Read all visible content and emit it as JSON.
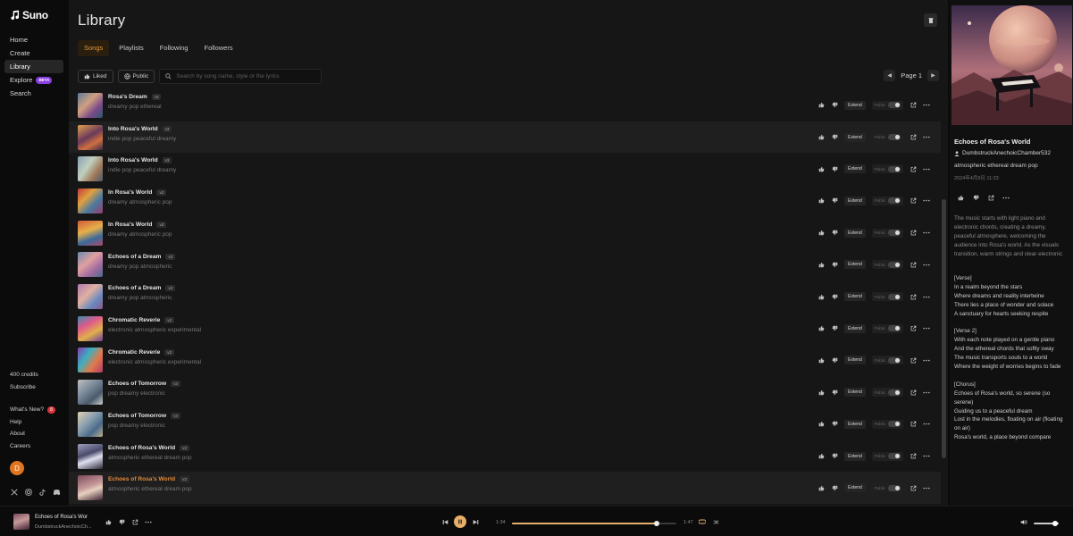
{
  "sidebar": {
    "logo": "Suno",
    "nav": [
      {
        "label": "Home"
      },
      {
        "label": "Create"
      },
      {
        "label": "Library"
      },
      {
        "label": "Explore",
        "badge": "BETA"
      },
      {
        "label": "Search"
      }
    ],
    "credits": "400 credits",
    "subscribe": "Subscribe",
    "whats_new": "What's New?",
    "whats_new_count": "8",
    "help": "Help",
    "about": "About",
    "careers": "Careers",
    "avatar_letter": "D"
  },
  "library": {
    "title": "Library",
    "tabs": [
      "Songs",
      "Playlists",
      "Following",
      "Followers"
    ],
    "active_tab": "Songs",
    "filters": {
      "liked": "Liked",
      "public": "Public"
    },
    "search_placeholder": "Search by song name, style or the lyrics",
    "page_label": "Page 1",
    "extend_label": "Extend",
    "public_label": "Public",
    "songs": [
      {
        "title": "Rosa's Dream",
        "version": "v3",
        "style": "dreamy pop ethereal"
      },
      {
        "title": "Into Rosa's World",
        "version": "v3",
        "style": "indie pop peaceful dreamy"
      },
      {
        "title": "Into Rosa's World",
        "version": "v3",
        "style": "indie pop peaceful dreamy"
      },
      {
        "title": "In Rosa's World",
        "version": "v3",
        "style": "dreamy atmospheric pop"
      },
      {
        "title": "In Rosa's World",
        "version": "v3",
        "style": "dreamy atmospheric pop"
      },
      {
        "title": "Echoes of a Dream",
        "version": "v3",
        "style": "dreamy pop atmospheric"
      },
      {
        "title": "Echoes of a Dream",
        "version": "v3",
        "style": "dreamy pop atmospheric"
      },
      {
        "title": "Chromatic Reverie",
        "version": "v3",
        "style": "electronic atmospheric experimental"
      },
      {
        "title": "Chromatic Reverie",
        "version": "v3",
        "style": "electronic atmospheric experimental"
      },
      {
        "title": "Echoes of Tomorrow",
        "version": "v3",
        "style": "pop dreamy electronic"
      },
      {
        "title": "Echoes of Tomorrow",
        "version": "v3",
        "style": "pop dreamy electronic"
      },
      {
        "title": "Echoes of Rosa's World",
        "version": "v3",
        "style": "atmospheric ethereal dream pop"
      },
      {
        "title": "Echoes of Rosa's World",
        "version": "v3",
        "style": "atmospheric ethereal dream pop"
      }
    ]
  },
  "detail": {
    "title": "Echoes of Rosa's World",
    "user": "DumbstruckAnechoicChamber532",
    "style": "atmospheric ethereal dream pop",
    "date": "2024年4月9日 11:23",
    "description": "The music starts with light piano and electronic chords, creating a dreamy, peaceful atmosphere, welcoming the audience into Rosa's world. As the visuals transition, warm strings and clear electronic",
    "lyrics": [
      "[Verse]",
      "In a realm beyond the stars",
      "Where dreams and reality intertwine",
      "There lies a place of wonder and solace",
      "A sanctuary for hearts seeking respite",
      "",
      "[Verse 2]",
      "With each note played on a gentle piano",
      "And the ethereal chords that softly sway",
      "The music transports souls to a world",
      "Where the weight of worries begins to fade",
      "",
      "[Chorus]",
      "Echoes of Rosa's world, so serene (so serene)",
      "Guiding us to a peaceful dream",
      "Lost in the melodies, floating on air (floating on air)",
      "Rosa's world, a place beyond compare"
    ]
  },
  "player": {
    "title": "Echoes of Rosa's Wor",
    "user": "DumbstruckAnechoicCh...",
    "current_time": "1:34",
    "duration": "1:47",
    "progress": 0.88,
    "volume": 0.85
  },
  "colors": {
    "accent": "#e6b06b",
    "active_tab": "#e0953a",
    "playing_title": "#e08a3a"
  }
}
